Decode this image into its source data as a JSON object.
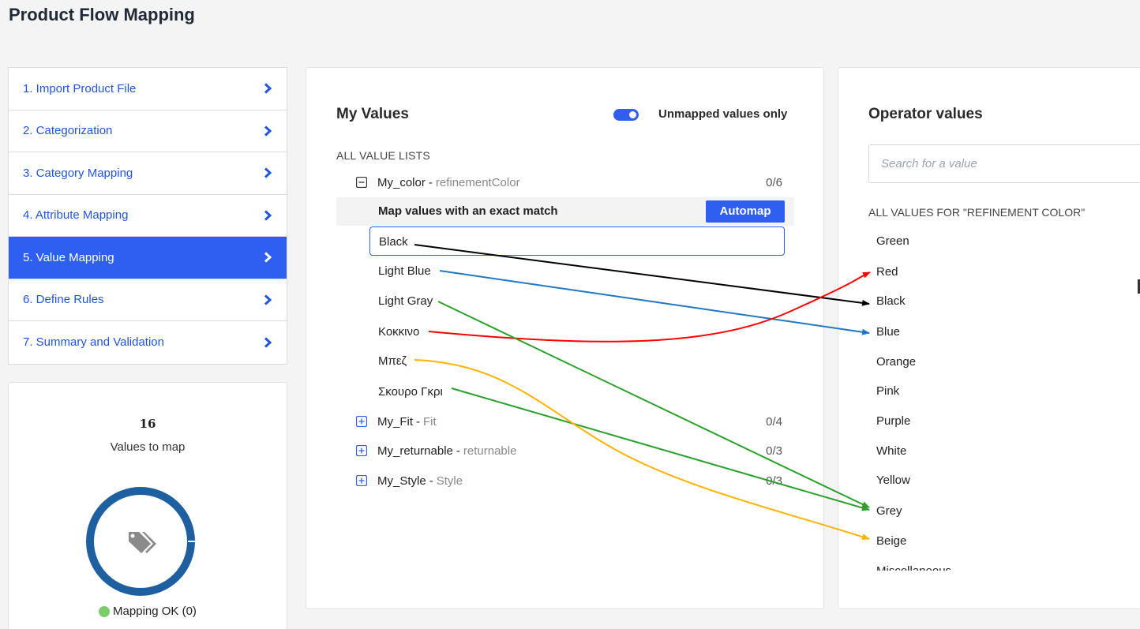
{
  "page_title": "Product Flow Mapping",
  "steps": [
    {
      "label": "1. Import Product File"
    },
    {
      "label": "2. Categorization"
    },
    {
      "label": "3. Category Mapping"
    },
    {
      "label": "4. Attribute Mapping"
    },
    {
      "label": "5. Value Mapping",
      "active": true
    },
    {
      "label": "6. Define Rules"
    },
    {
      "label": "7. Summary and Validation"
    }
  ],
  "stats": {
    "count": "16",
    "count_label": "Values to map",
    "status": "Mapping OK (0)",
    "progress_fraction": 0.0
  },
  "my_values": {
    "title": "My Values",
    "toggle_label": "Unmapped values only",
    "toggle_on": true,
    "section_label": "ALL VALUE LISTS",
    "exact_match_label": "Map values with an exact match",
    "automap_label": "Automap",
    "groups": [
      {
        "name": "My_color",
        "separator": "-",
        "attribute": "refinementColor",
        "count": "0/6",
        "expanded": true
      },
      {
        "name": "My_Fit",
        "separator": "-",
        "attribute": "Fit",
        "count": "0/4",
        "expanded": false
      },
      {
        "name": "My_returnable",
        "separator": "-",
        "attribute": "returnable",
        "count": "0/3",
        "expanded": false
      },
      {
        "name": "My_Style",
        "separator": "-",
        "attribute": "Style",
        "count": "0/3",
        "expanded": false
      }
    ],
    "values": [
      "Black",
      "Light Blue",
      "Light Gray",
      "Κοκκινο",
      "Μπεζ",
      "Σκουρο Γκρι"
    ]
  },
  "operator": {
    "title": "Operator values",
    "search_placeholder": "Search for a value",
    "section_label": "ALL VALUES FOR \"REFINEMENT COLOR\"",
    "values": [
      "Green",
      "Red",
      "Black",
      "Blue",
      "Orange",
      "Pink",
      "Purple",
      "White",
      "Yellow",
      "Grey",
      "Beige",
      "Miscellaneous"
    ]
  },
  "mappings": [
    {
      "from": "Black",
      "to": "Black",
      "color": "#000000"
    },
    {
      "from": "Light Blue",
      "to": "Blue",
      "color": "#1f77c8"
    },
    {
      "from": "Light Gray",
      "to": "Grey",
      "color": "#2ca02c"
    },
    {
      "from": "Κοκκινο",
      "to": "Red",
      "color": "#ff0000"
    },
    {
      "from": "Μπεζ",
      "to": "Beige",
      "color": "#ffb300"
    },
    {
      "from": "Σκουρο Γκρι",
      "to": "Grey",
      "color": "#2ca02c"
    }
  ],
  "colors": {
    "accent": "#2f5ff0",
    "donut": "#1e5fa0",
    "ok": "#7ccc6c"
  }
}
